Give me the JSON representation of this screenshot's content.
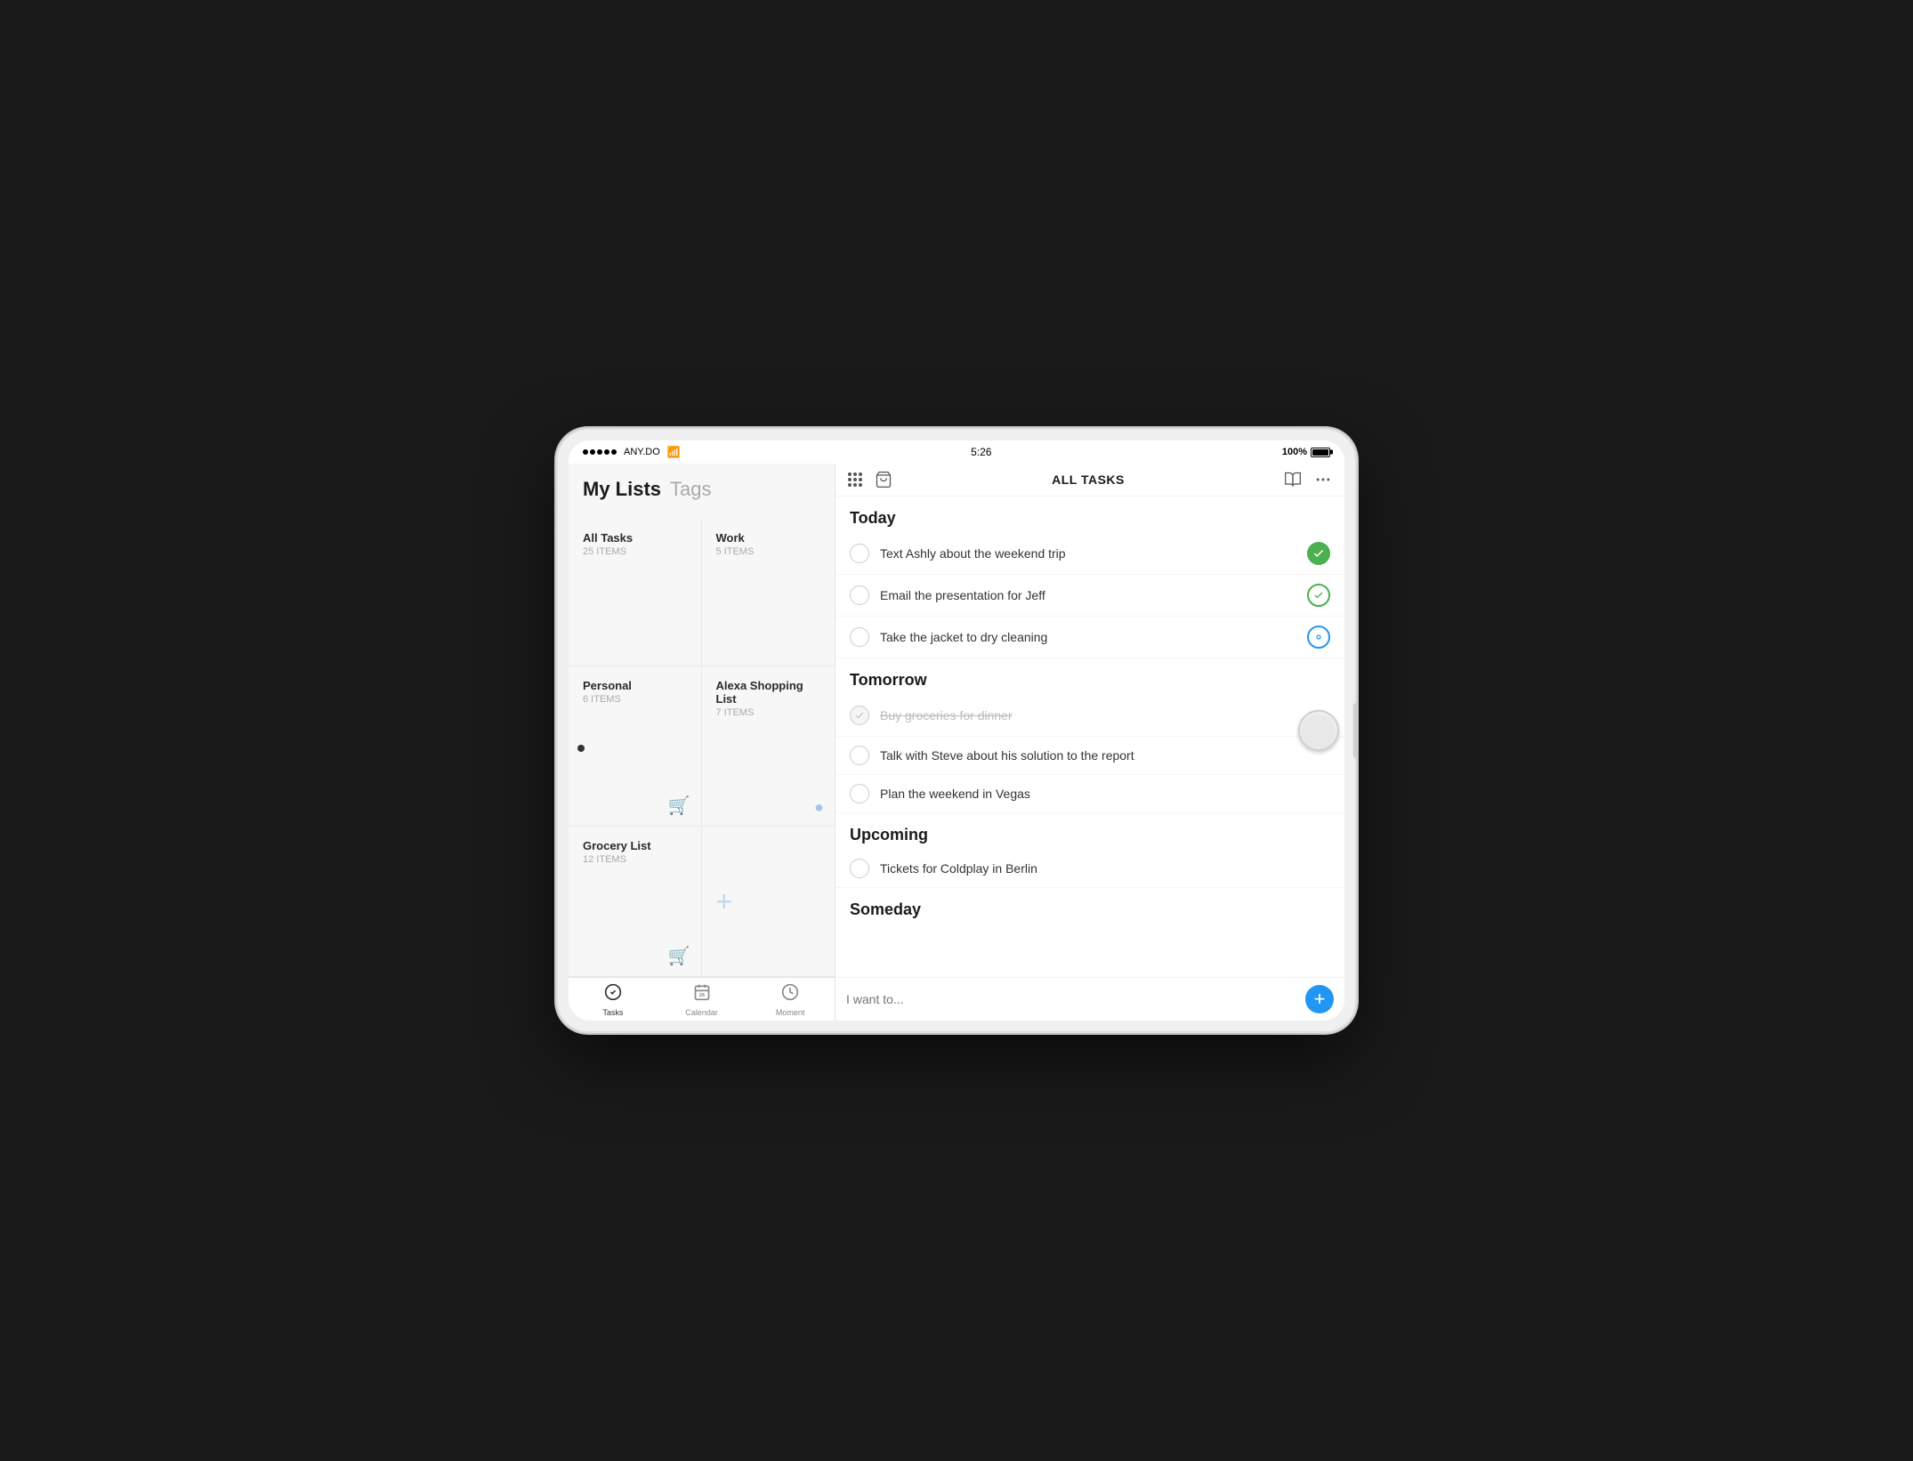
{
  "device": {
    "status_bar": {
      "carrier": "ANY.DO",
      "time": "5:26",
      "battery_percent": "100%"
    }
  },
  "sidebar": {
    "title_my_lists": "My Lists",
    "title_tags": "Tags",
    "lists": [
      {
        "id": "all-tasks",
        "name": "All Tasks",
        "count": "25 ITEMS",
        "icon": ""
      },
      {
        "id": "work",
        "name": "Work",
        "count": "5 ITEMS",
        "icon": ""
      },
      {
        "id": "personal",
        "name": "Personal",
        "count": "6 ITEMS",
        "icon": "🛒"
      },
      {
        "id": "alexa-shopping",
        "name": "Alexa Shopping List",
        "count": "7 ITEMS",
        "icon": "🔵"
      },
      {
        "id": "grocery-list",
        "name": "Grocery List",
        "count": "12 ITEMS",
        "icon": "🛒"
      },
      {
        "id": "new-list",
        "name": "",
        "count": "",
        "icon": "+"
      }
    ]
  },
  "bottom_tabs": [
    {
      "id": "tasks",
      "label": "Tasks",
      "active": true
    },
    {
      "id": "calendar",
      "label": "Calendar",
      "active": false
    },
    {
      "id": "moment",
      "label": "Moment",
      "active": false
    }
  ],
  "main_panel": {
    "title": "ALL TASKS",
    "sections": [
      {
        "id": "today",
        "header": "Today",
        "tasks": [
          {
            "id": "t1",
            "text": "Text Ashly about the weekend trip",
            "done": false,
            "badge": "green-filled"
          },
          {
            "id": "t2",
            "text": "Email the presentation for Jeff",
            "done": false,
            "badge": "green-outline"
          },
          {
            "id": "t3",
            "text": "Take the jacket to dry cleaning",
            "done": false,
            "badge": "blue-outline"
          }
        ]
      },
      {
        "id": "tomorrow",
        "header": "Tomorrow",
        "tasks": [
          {
            "id": "t4",
            "text": "Buy groceries for dinner",
            "done": true,
            "badge": "gray-x"
          },
          {
            "id": "t5",
            "text": "Talk with Steve about his solution to the report",
            "done": false,
            "badge": ""
          },
          {
            "id": "t6",
            "text": "Plan the weekend in Vegas",
            "done": false,
            "badge": ""
          }
        ]
      },
      {
        "id": "upcoming",
        "header": "Upcoming",
        "tasks": [
          {
            "id": "t7",
            "text": "Tickets for Coldplay in Berlin",
            "done": false,
            "badge": ""
          }
        ]
      },
      {
        "id": "someday",
        "header": "Someday",
        "tasks": []
      }
    ],
    "add_task_placeholder": "I want to..."
  }
}
